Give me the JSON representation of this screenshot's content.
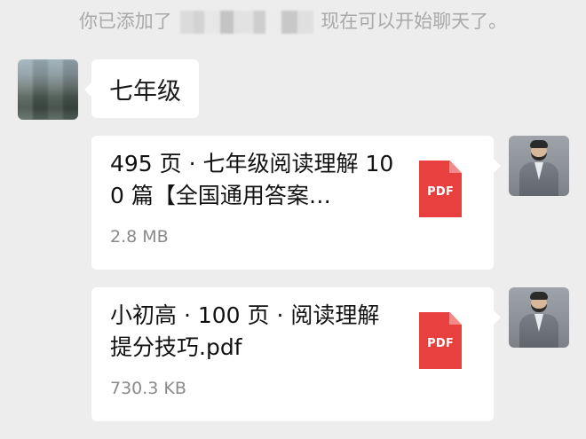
{
  "notice": {
    "prefix": "你已添加了",
    "suffix": "现在可以开始聊天了。"
  },
  "messages": [
    {
      "side": "left",
      "type": "text",
      "text": "七年级"
    },
    {
      "side": "right",
      "type": "file",
      "file_name": "495 页 · 七年级阅读理解 100 篇【全国通用答案…",
      "file_size": "2.8 MB",
      "file_icon": "pdf-icon",
      "file_icon_label": "PDF"
    },
    {
      "side": "right",
      "type": "file",
      "file_name": "小初高 · 100 页 · 阅读理解 提分技巧.pdf",
      "file_size": "730.3 KB",
      "file_icon": "pdf-icon",
      "file_icon_label": "PDF"
    }
  ],
  "colors": {
    "background": "#ededed",
    "bubble": "#ffffff",
    "pdf_red": "#e8403f",
    "muted_text": "#8a8a8a"
  }
}
